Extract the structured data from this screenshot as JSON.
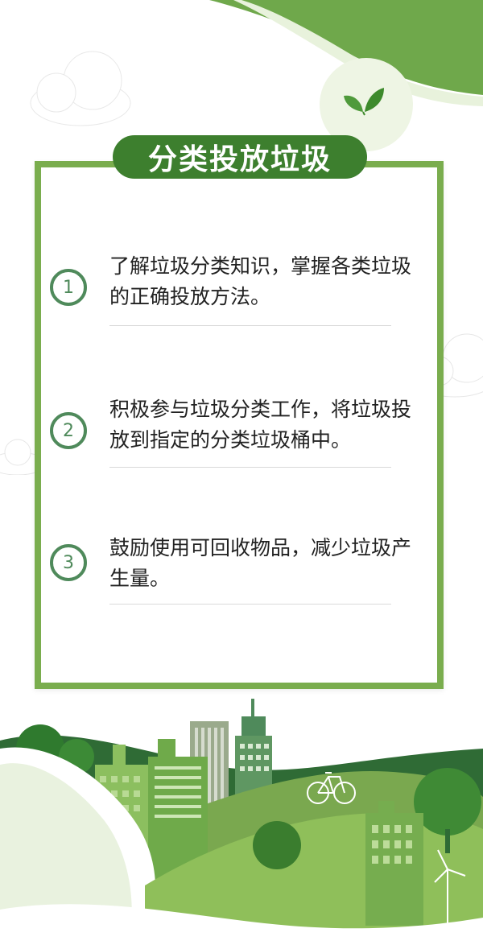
{
  "title": "分类投放垃圾",
  "items": [
    {
      "number": "1",
      "text": "了解垃圾分类知识，掌握各类垃圾的正确投放方法。"
    },
    {
      "number": "2",
      "text": "积极参与垃圾分类工作，将垃圾投放到指定的分类垃圾桶中。"
    },
    {
      "number": "3",
      "text": "鼓励使用可回收物品，减少垃圾产生量。"
    }
  ],
  "colors": {
    "frame": "#7aad4e",
    "title_bg": "#3d7f2e",
    "number_ring": "#4f8a5b",
    "dark_green": "#2f6b35",
    "mid_green": "#5e9a45",
    "light_green": "#8cbf5f"
  },
  "icons": {
    "leaf": "leaf-icon",
    "bicycle": "bicycle-icon",
    "wind_turbine": "wind-turbine-icon"
  }
}
